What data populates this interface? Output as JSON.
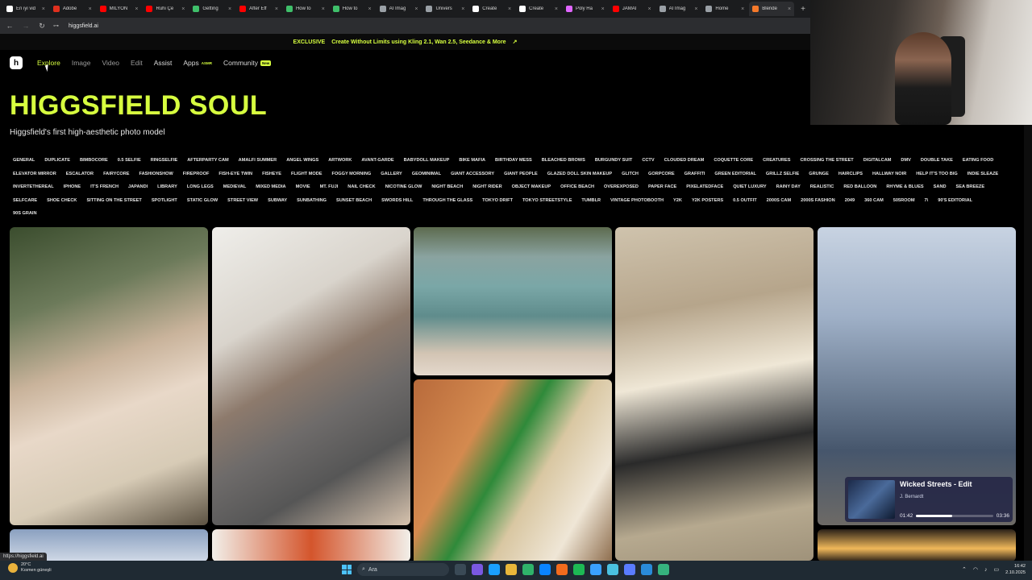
{
  "browser": {
    "tabs": [
      {
        "label": "En iyi vid",
        "color": "#ffffff",
        "active": false
      },
      {
        "label": "Adobe",
        "color": "#e0301e",
        "active": false
      },
      {
        "label": "MİLYON",
        "color": "#ff0000",
        "active": false
      },
      {
        "label": "Ruhi Çe",
        "color": "#ff0000",
        "active": false
      },
      {
        "label": "Getting",
        "color": "#3fbf6a",
        "active": false
      },
      {
        "label": "After Eff",
        "color": "#ff0000",
        "active": false
      },
      {
        "label": "How to",
        "color": "#3fbf6a",
        "active": false
      },
      {
        "label": "How to",
        "color": "#3fbf6a",
        "active": false
      },
      {
        "label": "AI Imag",
        "color": "#9aa0a6",
        "active": false
      },
      {
        "label": "Univers",
        "color": "#9aa0a6",
        "active": false
      },
      {
        "label": "Create",
        "color": "#ffffff",
        "active": false
      },
      {
        "label": "Create",
        "color": "#ffffff",
        "active": false
      },
      {
        "label": "Poly Ha",
        "color": "#e066ff",
        "active": false
      },
      {
        "label": "JAMAİ",
        "color": "#ff0000",
        "active": false
      },
      {
        "label": "AI Imag",
        "color": "#9aa0a6",
        "active": false
      },
      {
        "label": "Home",
        "color": "#9aa0a6",
        "active": false
      },
      {
        "label": "Blende",
        "color": "#f5792a",
        "active": true
      }
    ],
    "new_tab": "+",
    "url": "higgsfield.ai",
    "status_url": "https://higgsfield.ai"
  },
  "promo": {
    "badge": "EXCLUSIVE",
    "message": "Create Without Limits using Kling 2.1, Wan 2.5, Seedance & More",
    "arrow": "↗"
  },
  "nav": {
    "logo": "h",
    "items": [
      {
        "label": "Explore",
        "badge": "",
        "style": "active"
      },
      {
        "label": "Image",
        "badge": "",
        "style": "dim"
      },
      {
        "label": "Video",
        "badge": "",
        "style": "dim"
      },
      {
        "label": "Edit",
        "badge": "",
        "style": "dim"
      },
      {
        "label": "Assist",
        "badge": "",
        "style": "white"
      },
      {
        "label": "Apps",
        "badge": "ASMR",
        "style": "white"
      },
      {
        "label": "Community",
        "badge": "New",
        "style": "white"
      }
    ]
  },
  "hero": {
    "title": "HIGGSFIELD SOUL",
    "subtitle": "Higgsfield's first high-aesthetic photo model"
  },
  "styles": [
    "GENERAL",
    "DUPLICATE",
    "BIMBOCORE",
    "0.5 SELFIE",
    "RINGSELFIE",
    "AFTERPARTY CAM",
    "AMALFI SUMMER",
    "ANGEL WINGS",
    "ARTWORK",
    "AVANT-GARDE",
    "BABYDOLL MAKEUP",
    "BIKE MAFIA",
    "BIRTHDAY MESS",
    "BLEACHED BROWS",
    "BURGUNDY SUIT",
    "CCTV",
    "CLOUDED DREAM",
    "COQUETTE CORE",
    "CREATURES",
    "CROSSING THE STREET",
    "DIGITALCAM",
    "DMV",
    "DOUBLE TAKE",
    "EATING FOOD",
    "ELEVATOR MIRROR",
    "ESCALATOR",
    "FAIRYCORE",
    "FASHIONSHOW",
    "FIREPROOF",
    "FISH-EYE TWIN",
    "FISHEYE",
    "FLIGHT MODE",
    "FOGGY MORNING",
    "GALLERY",
    "GEOMINIMAL",
    "GIANT ACCESSORY",
    "GIANT PEOPLE",
    "GLAZED DOLL SKIN MAKEUP",
    "GLITCH",
    "GORPCORE",
    "GRAFFITI",
    "GREEN EDITORIAL",
    "GRILLZ SELFIE",
    "GRUNGE",
    "HAIRCLIPS",
    "HALLWAY NOIR",
    "HELP IT'S TOO BIG",
    "INDIE SLEAZE",
    "INVERTETHEREAL",
    "IPHONE",
    "IT'S FRENCH",
    "JAPANDI",
    "LIBRARY",
    "LONG LEGS",
    "MEDIEVAL",
    "MIXED MEDIA",
    "MOVIE",
    "MT. FUJI",
    "NAIL CHECK",
    "NICOTINE GLOW",
    "NIGHT BEACH",
    "NIGHT RIDER",
    "OBJECT MAKEUP",
    "OFFICE BEACH",
    "OVEREXPOSED",
    "PAPER FACE",
    "PIXELATEDFACE",
    "QUIET LUXURY",
    "RAINY DAY",
    "REALISTIC",
    "RED BALLOON",
    "RHYME & BLUES",
    "SAND",
    "SEA BREEZE",
    "SELFCARE",
    "SHOE CHECK",
    "SITTING ON THE STREET",
    "SPOTLIGHT",
    "STATIC GLOW",
    "STREET VIEW",
    "SUBWAY",
    "SUNBATHING",
    "SUNSET BEACH",
    "SWORDS HILL",
    "THROUGH THE GLASS",
    "TOKYO DRIFT",
    "TOKYO STREETSTYLE",
    "TUMBLR",
    "VINTAGE PHOTOBOOTH",
    "Y2K",
    "Y2K POSTERS",
    "0.5 OUTFIT",
    "2000S CAM",
    "2000S FASHION",
    "2049",
    "360 CAM",
    "505ROOM",
    "7\\",
    "90'S EDITORIAL",
    "90S GRAIN"
  ],
  "music_player": {
    "title": "Wicked Streets - Edit",
    "artist": "J. Bernardt",
    "elapsed": "01:42",
    "duration": "03:36",
    "progress": 0.47
  },
  "taskbar": {
    "weather_temp": "20°C",
    "weather_desc": "Kısmen güneşli",
    "search_placeholder": "Ara",
    "time": "16:42",
    "date": "2.10.2025",
    "app_icon_colors": [
      "#3a4a56",
      "#7a58e0",
      "#1aa0ff",
      "#e8b73a",
      "#2fb36a",
      "#0a84ff",
      "#f26b1d",
      "#1db954",
      "#3aa1ff",
      "#4ac1e0",
      "#5a7cff",
      "#2a8bd9",
      "#36b37e"
    ]
  }
}
